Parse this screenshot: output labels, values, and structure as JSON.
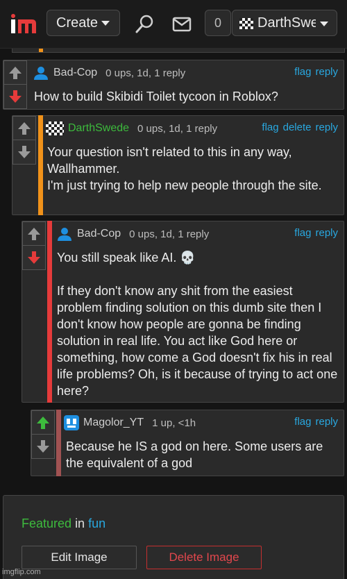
{
  "header": {
    "create_label": "Create",
    "notif_count": "0",
    "username": "DarthSwede"
  },
  "colors": {
    "green": "#3dbb3d",
    "blue": "#29a8e0",
    "red": "#e2474d",
    "orange": "#f0921a",
    "bg": "#141414",
    "panel": "#2a2a2a"
  },
  "comments": [
    {
      "user": "Bad-Cop",
      "meta": "0 ups, 1d, 1 reply",
      "actions": [
        "flag",
        "reply"
      ],
      "text": "How to build Skibidi Toilet tycoon in Roblox?",
      "vote": "downvoted",
      "user_color": "#cfcfcf"
    },
    {
      "user": "DarthSwede",
      "meta": "0 ups, 1d, 1 reply",
      "actions": [
        "flag",
        "delete",
        "reply"
      ],
      "text": "Your question isn't related to this in any way, Wallhammer.\nI'm just trying to help new people through the site.",
      "vote": "none",
      "user_color": "#3dbb3d",
      "bar_color": "#f0921a"
    },
    {
      "user": "Bad-Cop",
      "meta": "0 ups, 1d, 1 reply",
      "actions": [
        "flag",
        "reply"
      ],
      "text": "You still speak like AI. 💀\n\nIf they don't know any shit from the easiest problem finding solution on this dumb site then I don't know how people are gonna be finding solution in real life. You act like God here or something, how come a God doesn't fix his in real life problems? Oh, is it because of trying to act one here?",
      "vote": "downvoted",
      "user_color": "#cfcfcf",
      "bar_color": "#e53b3b"
    },
    {
      "user": "Magolor_YT",
      "meta": "1 up, <1h",
      "actions": [
        "flag",
        "reply"
      ],
      "text": "Because he IS a god on here. Some users are the equivalent of a god",
      "vote": "upvoted",
      "user_color": "#cfcfcf",
      "bar_color": "#a05252"
    }
  ],
  "featured": {
    "prefix": "Featured",
    "middle": "in",
    "stream": "fun"
  },
  "buttons": {
    "edit": "Edit Image",
    "delete": "Delete Image"
  },
  "watermark": "imgflip.com"
}
